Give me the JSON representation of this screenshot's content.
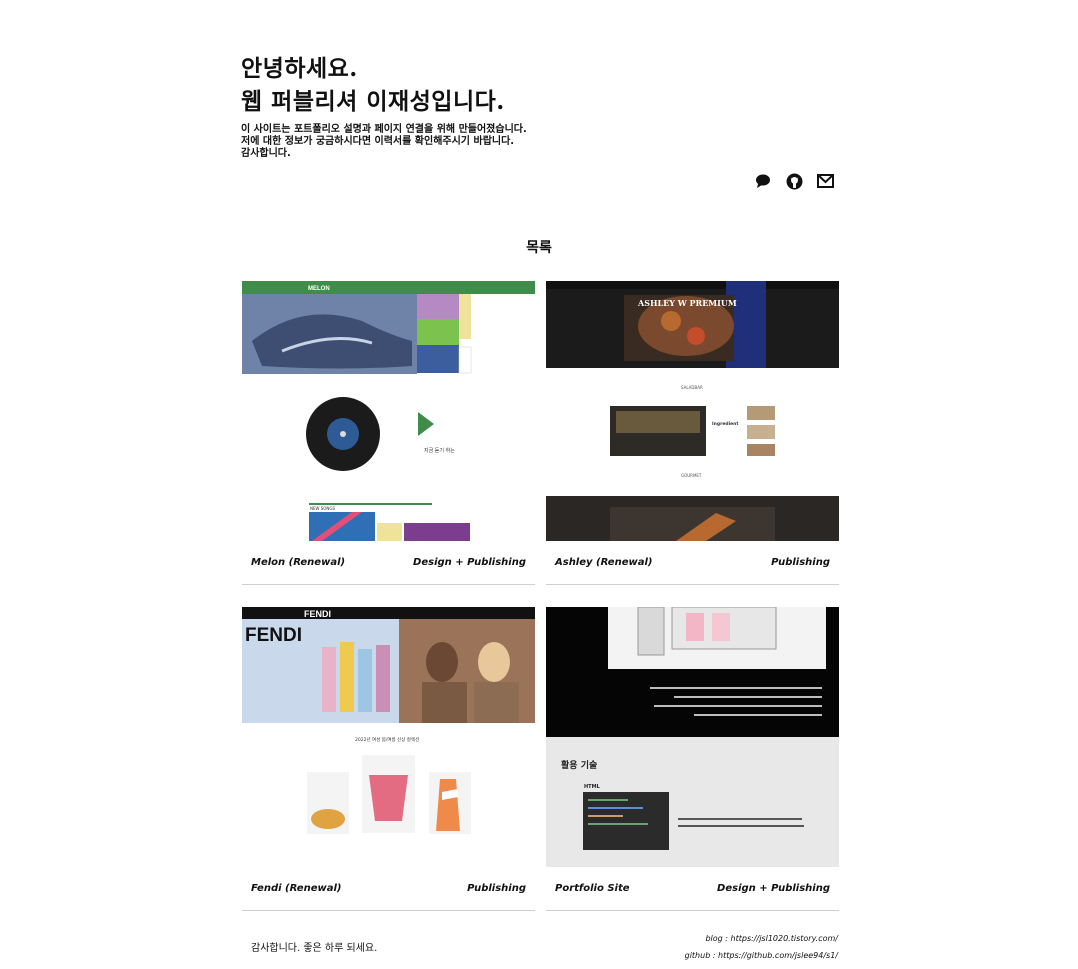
{
  "header": {
    "title_line1": "안녕하세요.",
    "title_line2": "웹 퍼블리셔 이재성입니다.",
    "intro_line1": "이 사이트는 포트폴리오 설명과 페이지 연결을 위해 만들어졌습니다.",
    "intro_line2": "저에 대한 정보가 궁금하시다면 이력서를 확인해주시기 바랍니다.",
    "intro_line3": "감사합니다."
  },
  "icons": [
    "chat-icon",
    "github-icon",
    "mail-icon"
  ],
  "list_title": "목록",
  "cards": [
    {
      "title": "Melon (Renewal)",
      "tag": "Design + Publishing",
      "thumb": {
        "logo": "MELON",
        "label1": "지금 듣기 하는",
        "label2": "NEW SONGS"
      }
    },
    {
      "title": "Ashley (Renewal)",
      "tag": "Publishing",
      "thumb": {
        "hero": "ASHLEY W PREMIUM",
        "label1": "SALADBAR",
        "label2": "GOURMET",
        "label3": "Ingredient"
      }
    },
    {
      "title": "Fendi (Renewal)",
      "tag": "Publishing",
      "thumb": {
        "logo": "FENDI",
        "hero": "FENDI",
        "label1": "2022년 여성 봄/여름 신상 컬렉션"
      }
    },
    {
      "title": "Portfolio Site",
      "tag": "Design + Publishing",
      "thumb": {
        "section": "활용 기술",
        "label1": "HTML"
      }
    }
  ],
  "footer": {
    "thanks": "감사합니다. 좋은 하루 되세요.",
    "blog": "blog : https://jsl1020.tistory.com/",
    "github": "github : https://github.com/jslee94/s1/"
  },
  "colors": {
    "melon_green": "#3f8c4b",
    "ashley_dark": "#1b1b1b",
    "divider": "#cfcfcf"
  }
}
